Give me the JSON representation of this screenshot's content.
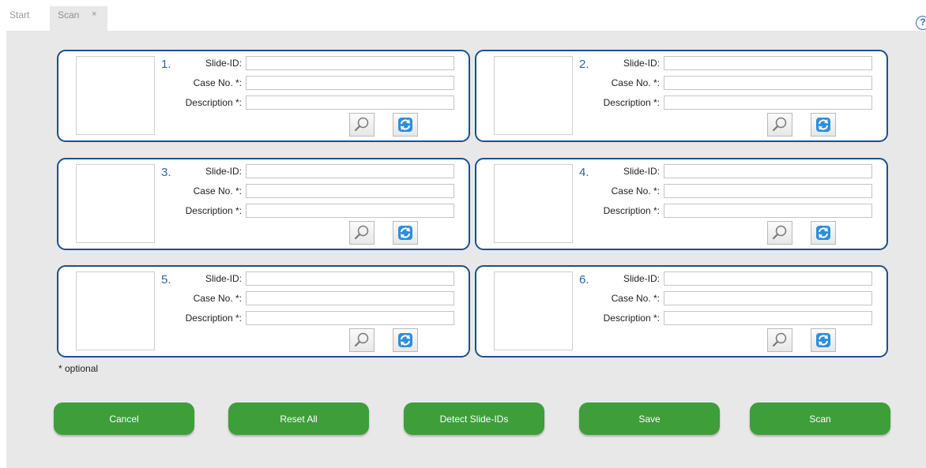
{
  "tabs": {
    "start_label": "Start",
    "scan_label": "Scan",
    "close_glyph": "×"
  },
  "help": {
    "glyph": "?"
  },
  "fields": {
    "slide_id_label": "Slide-ID:",
    "case_no_label": "Case No. *:",
    "description_label": "Description *:"
  },
  "slots": [
    {
      "number": "1.",
      "slide_id": "",
      "case_no": "",
      "description": ""
    },
    {
      "number": "2.",
      "slide_id": "",
      "case_no": "",
      "description": ""
    },
    {
      "number": "3.",
      "slide_id": "",
      "case_no": "",
      "description": ""
    },
    {
      "number": "4.",
      "slide_id": "",
      "case_no": "",
      "description": ""
    },
    {
      "number": "5.",
      "slide_id": "",
      "case_no": "",
      "description": ""
    },
    {
      "number": "6.",
      "slide_id": "",
      "case_no": "",
      "description": ""
    }
  ],
  "footnote": "* optional",
  "actions": {
    "cancel": "Cancel",
    "reset_all": "Reset All",
    "detect": "Detect Slide-IDs",
    "save": "Save",
    "scan": "Scan"
  },
  "icons": {
    "search": "magnifier-icon",
    "refresh": "refresh-icon"
  },
  "colors": {
    "card_border": "#1d4f8c",
    "slot_number": "#2c64a6",
    "action_button": "#3e9e3a",
    "background": "#e8e8e8"
  }
}
